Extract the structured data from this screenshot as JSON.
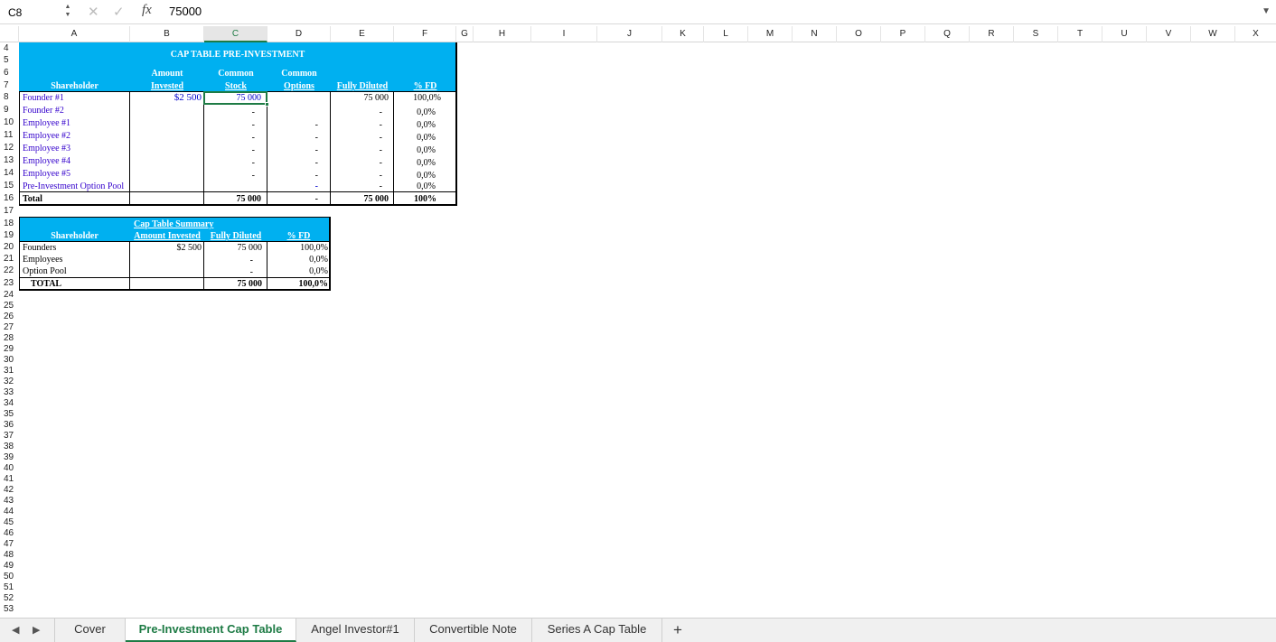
{
  "formula_bar": {
    "name_box": "C8",
    "fx_label": "fx",
    "formula": "75000"
  },
  "columns": [
    "A",
    "B",
    "C",
    "D",
    "E",
    "F",
    "G",
    "H",
    "I",
    "J",
    "K",
    "L",
    "M",
    "N",
    "O",
    "P",
    "Q",
    "R",
    "S",
    "T",
    "U",
    "V",
    "W",
    "X"
  ],
  "selected_column": "C",
  "rows": [
    "4",
    "5",
    "6",
    "7",
    "8",
    "9",
    "10",
    "11",
    "12",
    "13",
    "14",
    "15",
    "16",
    "17",
    "18",
    "19",
    "20",
    "21",
    "22",
    "23",
    "24",
    "25",
    "26",
    "27",
    "28",
    "29",
    "30",
    "31",
    "32",
    "33",
    "34",
    "35",
    "36",
    "37",
    "38",
    "39",
    "40",
    "41",
    "42",
    "43",
    "44",
    "45",
    "46",
    "47",
    "48",
    "49",
    "50",
    "51",
    "52",
    "53"
  ],
  "cap_table": {
    "title": "CAP TABLE PRE-INVESTMENT",
    "headers": {
      "shareholder": "Shareholder",
      "amount_line1": "Amount",
      "amount_line2": "Invested",
      "common_line1": "Common",
      "common_line2": "Stock",
      "options_line1": "Common",
      "options_line2": "Options",
      "fully_diluted": "Fully Diluted",
      "pct_fd": "% FD"
    },
    "rows": [
      {
        "name": "Founder #1",
        "amount": "$2 500",
        "common": "75 000",
        "options": "",
        "fd": "75 000",
        "pct": "100,0%"
      },
      {
        "name": "Founder #2",
        "amount": "",
        "common": "-",
        "options": "",
        "fd": "-",
        "pct": "0,0%"
      },
      {
        "name": "Employee #1",
        "amount": "",
        "common": "-",
        "options": "-",
        "fd": "-",
        "pct": "0,0%"
      },
      {
        "name": "Employee #2",
        "amount": "",
        "common": "-",
        "options": "-",
        "fd": "-",
        "pct": "0,0%"
      },
      {
        "name": "Employee #3",
        "amount": "",
        "common": "-",
        "options": "-",
        "fd": "-",
        "pct": "0,0%"
      },
      {
        "name": "Employee #4",
        "amount": "",
        "common": "-",
        "options": "-",
        "fd": "-",
        "pct": "0,0%"
      },
      {
        "name": "Employee #5",
        "amount": "",
        "common": "-",
        "options": "-",
        "fd": "-",
        "pct": "0,0%"
      },
      {
        "name": "Pre-Investment Option Pool",
        "amount": "",
        "common": "",
        "options": "-",
        "fd": "-",
        "pct": "0,0%"
      }
    ],
    "total": {
      "label": "Total",
      "common": "75 000",
      "options": "-",
      "fd": "75 000",
      "pct": "100%"
    }
  },
  "summary": {
    "title": "Cap Table Summary",
    "headers": {
      "shareholder": "Shareholder",
      "amount": "Amount Invested",
      "fd": "Fully Diluted",
      "pct": "% FD"
    },
    "rows": [
      {
        "name": "Founders",
        "amount": "$2 500",
        "fd": "75 000",
        "pct": "100,0%"
      },
      {
        "name": "Employees",
        "amount": "",
        "fd": "-",
        "pct": "0,0%"
      },
      {
        "name": "Option Pool",
        "amount": "",
        "fd": "-",
        "pct": "0,0%"
      }
    ],
    "total": {
      "label": "TOTAL",
      "fd": "75 000",
      "pct": "100,0%"
    }
  },
  "sheets": [
    "Cover",
    "Pre-Investment Cap Table",
    "Angel Investor#1",
    "Convertible Note",
    "Series A Cap Table"
  ],
  "active_sheet": "Pre-Investment Cap Table",
  "colors": {
    "header_fill": "#00b0f0",
    "selection": "#1e7b45",
    "input_blue": "#0000cc"
  }
}
